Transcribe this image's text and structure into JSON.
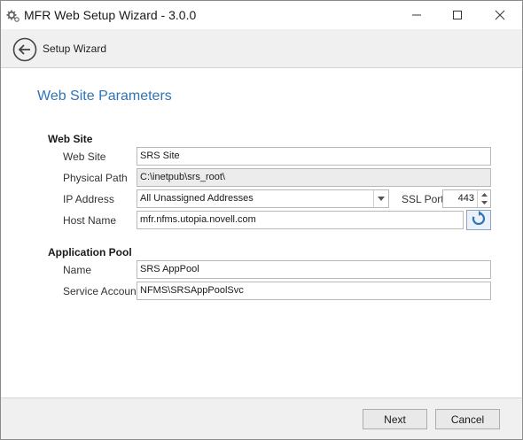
{
  "window": {
    "title": "MFR Web Setup Wizard - 3.0.0"
  },
  "nav": {
    "title": "Setup Wizard"
  },
  "page": {
    "title": "Web Site Parameters"
  },
  "web_site": {
    "section_label": "Web Site",
    "site_label": "Web Site",
    "site_value": "SRS Site",
    "path_label": "Physical Path",
    "path_value": "C:\\inetpub\\srs_root\\",
    "ip_label": "IP Address",
    "ip_value": "All Unassigned Addresses",
    "ssl_label": "SSL Port",
    "ssl_value": "443",
    "host_label": "Host Name",
    "host_value": "mfr.nfms.utopia.novell.com"
  },
  "app_pool": {
    "section_label": "Application Pool",
    "name_label": "Name",
    "name_value": "SRS AppPool",
    "account_label": "Service Account",
    "account_value": "NFMS\\SRSAppPoolSvc"
  },
  "footer": {
    "next_label": "Next",
    "cancel_label": "Cancel"
  },
  "icons": {
    "app": "gears-icon",
    "back": "back-arrow-icon",
    "refresh": "refresh-icon",
    "dropdown": "chevron-down-icon"
  },
  "colors": {
    "accent": "#2e74b5",
    "footer_bg": "#f0f0f0"
  }
}
